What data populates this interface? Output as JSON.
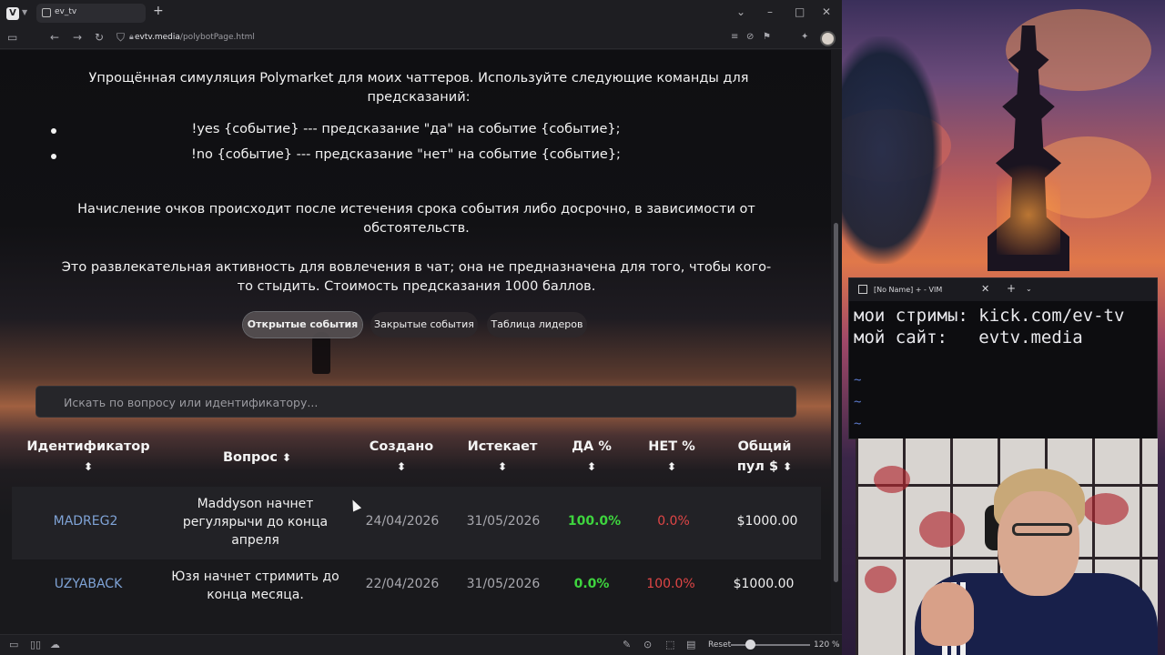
{
  "browser": {
    "tab_title": "ev_tv",
    "url_domain": "evtv.media",
    "url_path": "/polybotPage.html",
    "statusbar": {
      "reset_label": "Reset",
      "zoom": "120 %"
    }
  },
  "page": {
    "intro": "Упрощённая симуляция Polymarket для моих чаттеров. Используйте следующие команды для предсказаний:",
    "commands": [
      "!yes {событие} --- предсказание \"да\" на событие {событие};",
      "!no {событие} --- предсказание \"нет\" на событие {событие};"
    ],
    "scoring_note": "Начисление очков происходит после истечения срока события либо досрочно, в зависимости от обстоятельств.",
    "disclaimer": "Это развлекательная активность для вовлечения в чат; она не предназначена для того, чтобы кого-то стыдить. Стоимость предсказания 1000 баллов.",
    "tabs": [
      {
        "label": "Открытые события",
        "active": true
      },
      {
        "label": "Закрытые события",
        "active": false
      },
      {
        "label": "Таблица лидеров",
        "active": false
      }
    ],
    "search_placeholder": "Искать по вопросу или идентификатору...",
    "table": {
      "headers": {
        "id": "Идентификатор",
        "question": "Вопрос",
        "created": "Создано",
        "expires": "Истекает",
        "yes": "ДА %",
        "no": "НЕТ %",
        "pool_line1": "Общий",
        "pool_line2": "пул $",
        "sort_icon": "⬍"
      },
      "rows": [
        {
          "id": "MADREG2",
          "question_lines": [
            "Maddyson начнет",
            "регулярычи до конца",
            "апреля"
          ],
          "created": "24/04/2026",
          "expires": "31/05/2026",
          "yes": "100.0%",
          "no": "0.0%",
          "pool": "$1000.00"
        },
        {
          "id": "UZYABACK",
          "question_lines": [
            "Юзя начнет стримить до",
            "конца месяца."
          ],
          "created": "22/04/2026",
          "expires": "31/05/2026",
          "yes": "0.0%",
          "no": "100.0%",
          "pool": "$1000.00"
        }
      ]
    }
  },
  "vim": {
    "tab_title": "[No Name] + - VIM",
    "lines": [
      "мои стримы: kick.com/ev-tv",
      "мой сайт:   evtv.media"
    ],
    "tilde": "~"
  },
  "colors": {
    "link": "#7fa3d6",
    "yes_green": "#3ed43e",
    "no_red": "#e04646"
  }
}
